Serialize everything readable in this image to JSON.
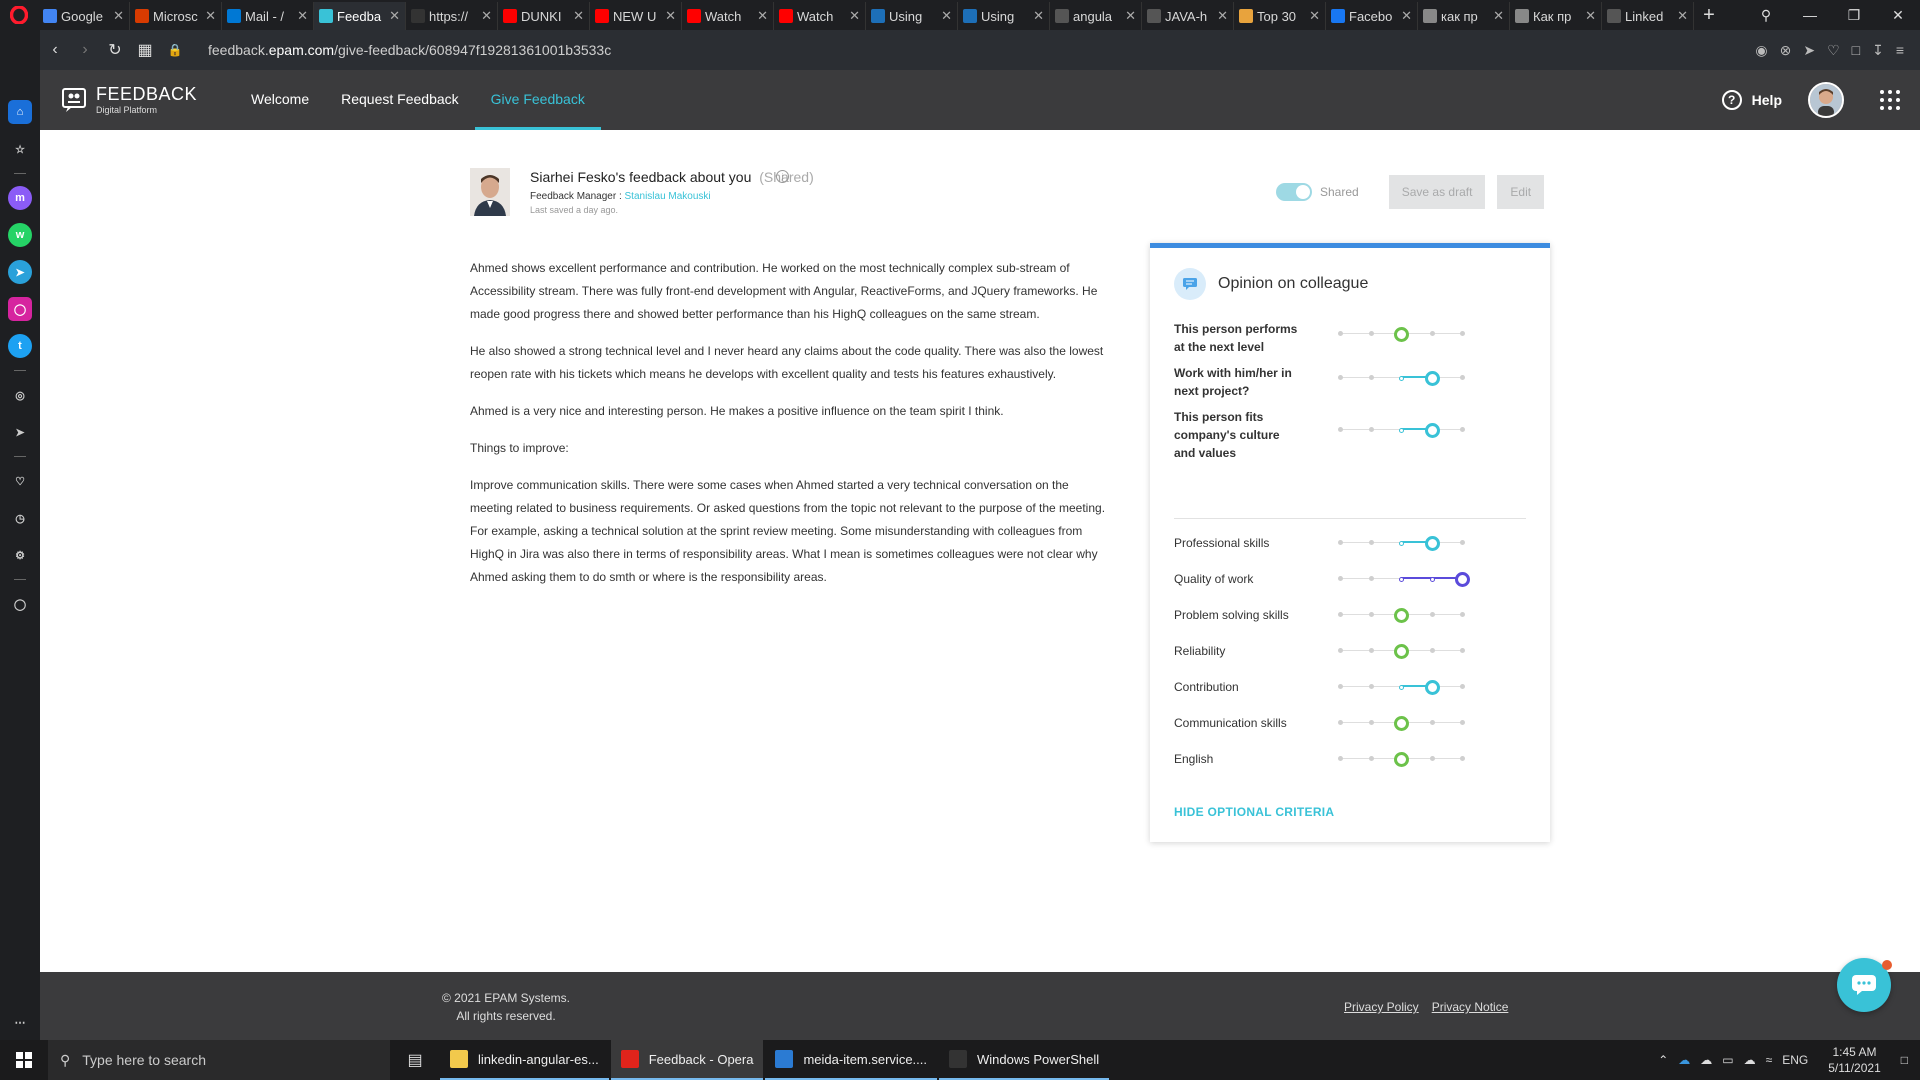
{
  "browser": {
    "tabs": [
      {
        "label": "Google",
        "color": "#4285f4"
      },
      {
        "label": "Microsc",
        "color": "#d83b01"
      },
      {
        "label": "Mail - /",
        "color": "#0078d4"
      },
      {
        "label": "Feedba",
        "color": "#39c2d7",
        "active": true
      },
      {
        "label": "https://",
        "color": "#333333"
      },
      {
        "label": "DUNKI",
        "color": "#ff0000"
      },
      {
        "label": "NEW U",
        "color": "#ff0000"
      },
      {
        "label": "Watch",
        "color": "#ff0000"
      },
      {
        "label": "Watch",
        "color": "#ff0000"
      },
      {
        "label": "Using",
        "color": "#1d6fb8"
      },
      {
        "label": "Using",
        "color": "#1d6fb8"
      },
      {
        "label": "angula",
        "color": "#555555"
      },
      {
        "label": "JAVA-h",
        "color": "#555555"
      },
      {
        "label": "Top 30",
        "color": "#e8a33d"
      },
      {
        "label": "Facebo",
        "color": "#1877f2"
      },
      {
        "label": "как пр",
        "color": "#888888"
      },
      {
        "label": "Как пр",
        "color": "#888888"
      },
      {
        "label": "Linked",
        "color": "#555555"
      }
    ],
    "url_prefix": "feedback.",
    "url_domain": "epam.com",
    "url_path": "/give-feedback/608947f19281361001b3533c"
  },
  "app": {
    "logo_title": "FEEDBACK",
    "logo_subtitle": "Digital Platform",
    "nav": {
      "welcome": "Welcome",
      "request": "Request Feedback",
      "give": "Give Feedback"
    },
    "help_label": "Help"
  },
  "feedback": {
    "title": "Siarhei Fesko's feedback about you",
    "shared_tag": "(Shared)",
    "manager_label": "Feedback Manager :",
    "manager_name": "Stanislau Makouski",
    "last_saved": "Last saved a day ago.",
    "toggle_label": "Shared",
    "save_draft_label": "Save as draft",
    "edit_label": "Edit",
    "paragraphs": [
      "Ahmed shows excellent performance and contribution. He worked on the most technically complex sub-stream of Accessibility stream. There was fully front-end development with Angular, ReactiveForms, and JQuery frameworks. He made good progress there and showed better performance than his HighQ colleagues on the same stream.",
      "He also showed a strong technical level and I never heard any claims about the code quality. There was also the lowest reopen rate with his tickets which means he develops with excellent quality and tests his features exhaustively.",
      "Ahmed is a very nice and interesting person. He makes a positive influence on the team spirit I think.",
      "Things to improve:",
      "Improve communication skills. There were some cases when Ahmed started a very technical conversation on the meeting related to business requirements. Or asked questions from the topic not relevant to the purpose of the meeting. For example, asking a technical solution at the sprint review meeting. Some misunderstanding with colleagues from HighQ in Jira was also there in terms of responsibility areas. What I mean is sometimes colleagues were not clear why Ahmed asking them to do smth or where is the responsibility areas."
    ]
  },
  "opinion": {
    "title": "Opinion on colleague",
    "scale_points": 5,
    "colors": {
      "green": "#6cc24a",
      "cyan": "#39c2d7",
      "purple": "#5b4bdb"
    },
    "main_criteria": [
      {
        "label": "This person performs at the next level",
        "level": 3,
        "color": "green"
      },
      {
        "label": "Work with him/her in next project?",
        "level": 4,
        "color": "cyan"
      },
      {
        "label": "This person fits company's culture and values",
        "level": 4,
        "color": "cyan"
      }
    ],
    "optional_criteria": [
      {
        "label": "Professional skills",
        "level": 4,
        "color": "cyan"
      },
      {
        "label": "Quality of work",
        "level": 5,
        "color": "purple"
      },
      {
        "label": "Problem solving skills",
        "level": 3,
        "color": "green"
      },
      {
        "label": "Reliability",
        "level": 3,
        "color": "green"
      },
      {
        "label": "Contribution",
        "level": 4,
        "color": "cyan"
      },
      {
        "label": "Communication skills",
        "level": 3,
        "color": "green"
      },
      {
        "label": "English",
        "level": 3,
        "color": "green"
      }
    ],
    "hide_link": "HIDE OPTIONAL CRITERIA"
  },
  "footer": {
    "copyright_line1": "© 2021 EPAM Systems.",
    "copyright_line2": "All rights reserved.",
    "privacy_policy": "Privacy Policy",
    "privacy_notice": "Privacy Notice"
  },
  "taskbar": {
    "search_placeholder": "Type here to search",
    "apps": [
      {
        "label": "linkedin-angular-es...",
        "color": "#f2c94c"
      },
      {
        "label": "Feedback - Opera",
        "color": "#e0241b",
        "active": true
      },
      {
        "label": "meida-item.service....",
        "color": "#2b7bd3"
      },
      {
        "label": "Windows PowerShell",
        "color": "#333333"
      }
    ],
    "language": "ENG",
    "time": "1:45 AM",
    "date": "5/11/2021"
  }
}
